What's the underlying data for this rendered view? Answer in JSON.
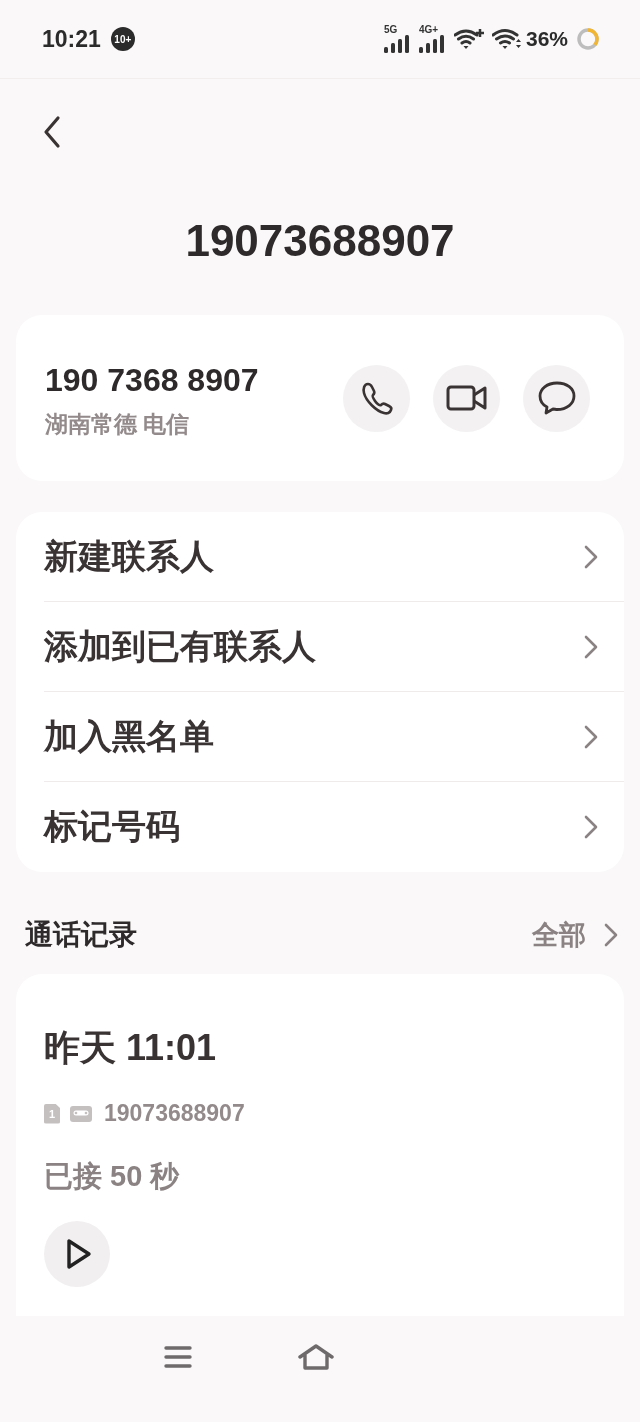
{
  "status_bar": {
    "time": "10:21",
    "notification_badge": "10+",
    "networks": [
      {
        "label": "5G"
      },
      {
        "label": "4G+"
      }
    ],
    "battery": "36%"
  },
  "title": "19073688907",
  "number_card": {
    "number": "190 7368 8907",
    "location": "湖南常德 电信",
    "actions": [
      {
        "kind": "call"
      },
      {
        "kind": "video"
      },
      {
        "kind": "message"
      }
    ]
  },
  "menu": [
    {
      "label": "新建联系人"
    },
    {
      "label": "添加到已有联系人"
    },
    {
      "label": "加入黑名单"
    },
    {
      "label": "标记号码"
    }
  ],
  "call_history": {
    "title": "通话记录",
    "view_all": "全部",
    "entries": [
      {
        "time": "昨天 11:01",
        "sim": "1",
        "number": "19073688907",
        "status": "已接 50 秒"
      }
    ]
  }
}
